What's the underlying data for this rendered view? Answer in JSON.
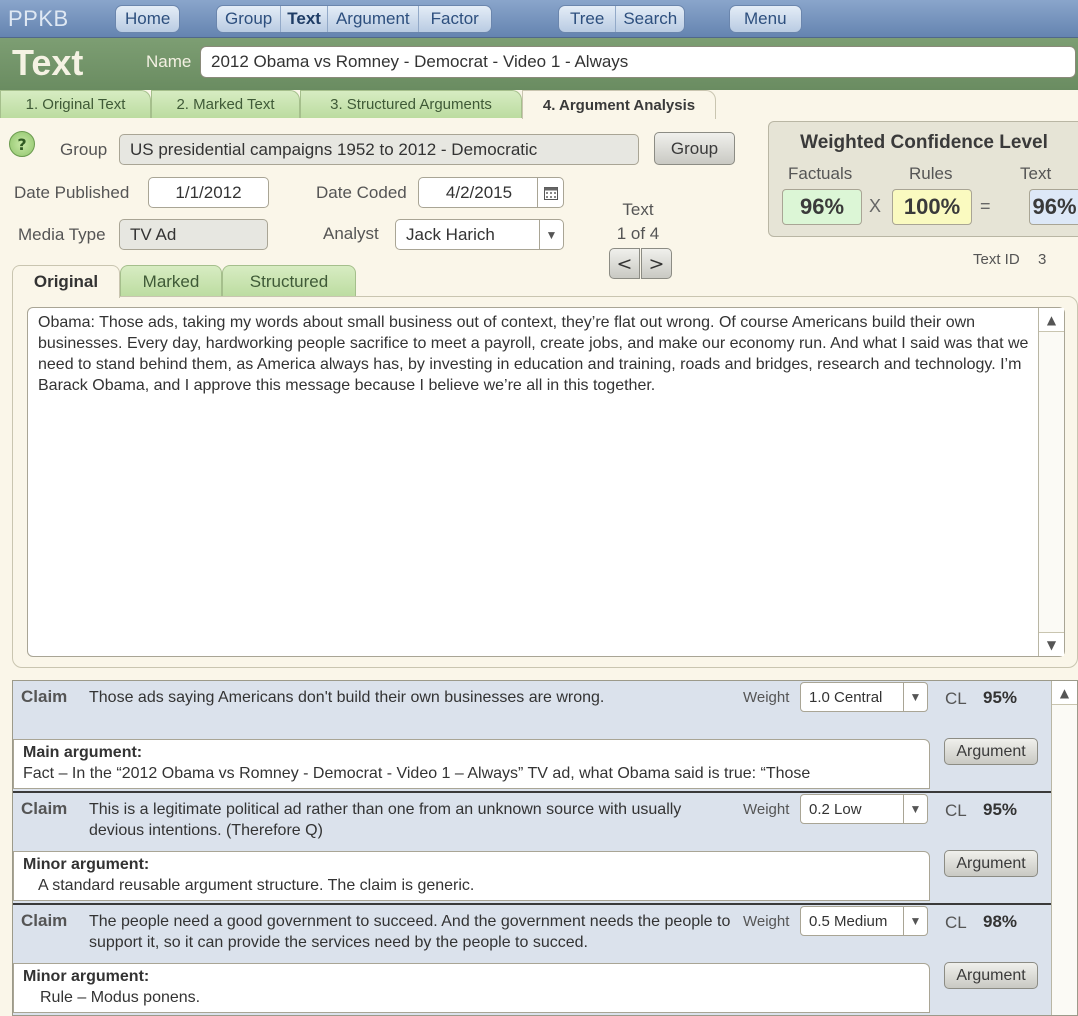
{
  "app": {
    "logo": "PPKB",
    "title": "Text",
    "name_label": "Name",
    "name_value": "2012 Obama vs Romney - Democrat - Video 1 - Always"
  },
  "nav": {
    "home": "Home",
    "group": "Group",
    "text": "Text",
    "argument": "Argument",
    "factor": "Factor",
    "tree": "Tree",
    "search": "Search",
    "menu": "Menu"
  },
  "main_tabs": [
    "1. Original Text",
    "2. Marked Text",
    "3. Structured Arguments",
    "4. Argument Analysis"
  ],
  "form": {
    "help": "?",
    "group_label": "Group",
    "group_value": "US presidential campaigns 1952 to 2012 - Democratic",
    "group_button": "Group",
    "date_published_label": "Date Published",
    "date_published": "1/1/2012",
    "date_coded_label": "Date Coded",
    "date_coded": "4/2/2015",
    "media_type_label": "Media Type",
    "media_type": "TV Ad",
    "analyst_label": "Analyst",
    "analyst": "Jack Harich"
  },
  "pager": {
    "label": "Text",
    "position": "1 of 4",
    "prev": "<",
    "next": ">"
  },
  "text_id": {
    "label": "Text ID",
    "value": "3"
  },
  "wcl": {
    "title": "Weighted Confidence Level",
    "factuals_label": "Factuals",
    "factuals": "96%",
    "rules_label": "Rules",
    "rules": "100%",
    "text_label": "Text",
    "text": "96%",
    "times": "X",
    "equals": "="
  },
  "sub_tabs": [
    "Original",
    "Marked",
    "Structured"
  ],
  "body_text": "Obama: Those ads, taking my words about small business out of context, they’re flat out wrong. Of course Americans build their own businesses. Every day, hardworking people sacrifice to meet a payroll, create jobs, and make our economy run. And what I said was that we need to stand behind them, as America always has, by investing in education and training, roads and bridges, research and technology. I’m Barack Obama, and I approve this message because I believe we’re all in this together.",
  "claims": [
    {
      "label": "Claim",
      "text": "Those ads saying Americans don't build their own businesses are wrong.",
      "weight_label": "Weight",
      "weight": "1.0 Central",
      "cl_label": "CL",
      "cl": "95%",
      "arg_title": "Main argument:",
      "arg_text": "Fact – In the “2012 Obama vs Romney - Democrat - Video 1 – Always” TV ad, what Obama said is true: “Those",
      "arg_button": "Argument"
    },
    {
      "label": "Claim",
      "text": "This is a legitimate political ad rather than one from an unknown source with usually devious intentions. (Therefore Q)",
      "weight_label": "Weight",
      "weight": "0.2 Low",
      "cl_label": "CL",
      "cl": "95%",
      "arg_title": "Minor argument:",
      "arg_text": "A standard reusable argument structure. The claim is generic.",
      "arg_button": "Argument"
    },
    {
      "label": "Claim",
      "text": "The people need a good government to succeed. And the government needs the people to support it, so it can provide the services need by the people to succed.",
      "weight_label": "Weight",
      "weight": "0.5 Medium",
      "cl_label": "CL",
      "cl": "98%",
      "arg_title": "Minor argument:",
      "arg_text": "Rule – Modus ponens.",
      "arg_button": "Argument"
    }
  ],
  "colors": {
    "nav_blue": "#6f8db6",
    "header_green": "#6f9165",
    "factuals_bg": "#dcf6d6",
    "rules_bg": "#fafac0",
    "text_bg": "#dde8f7"
  }
}
